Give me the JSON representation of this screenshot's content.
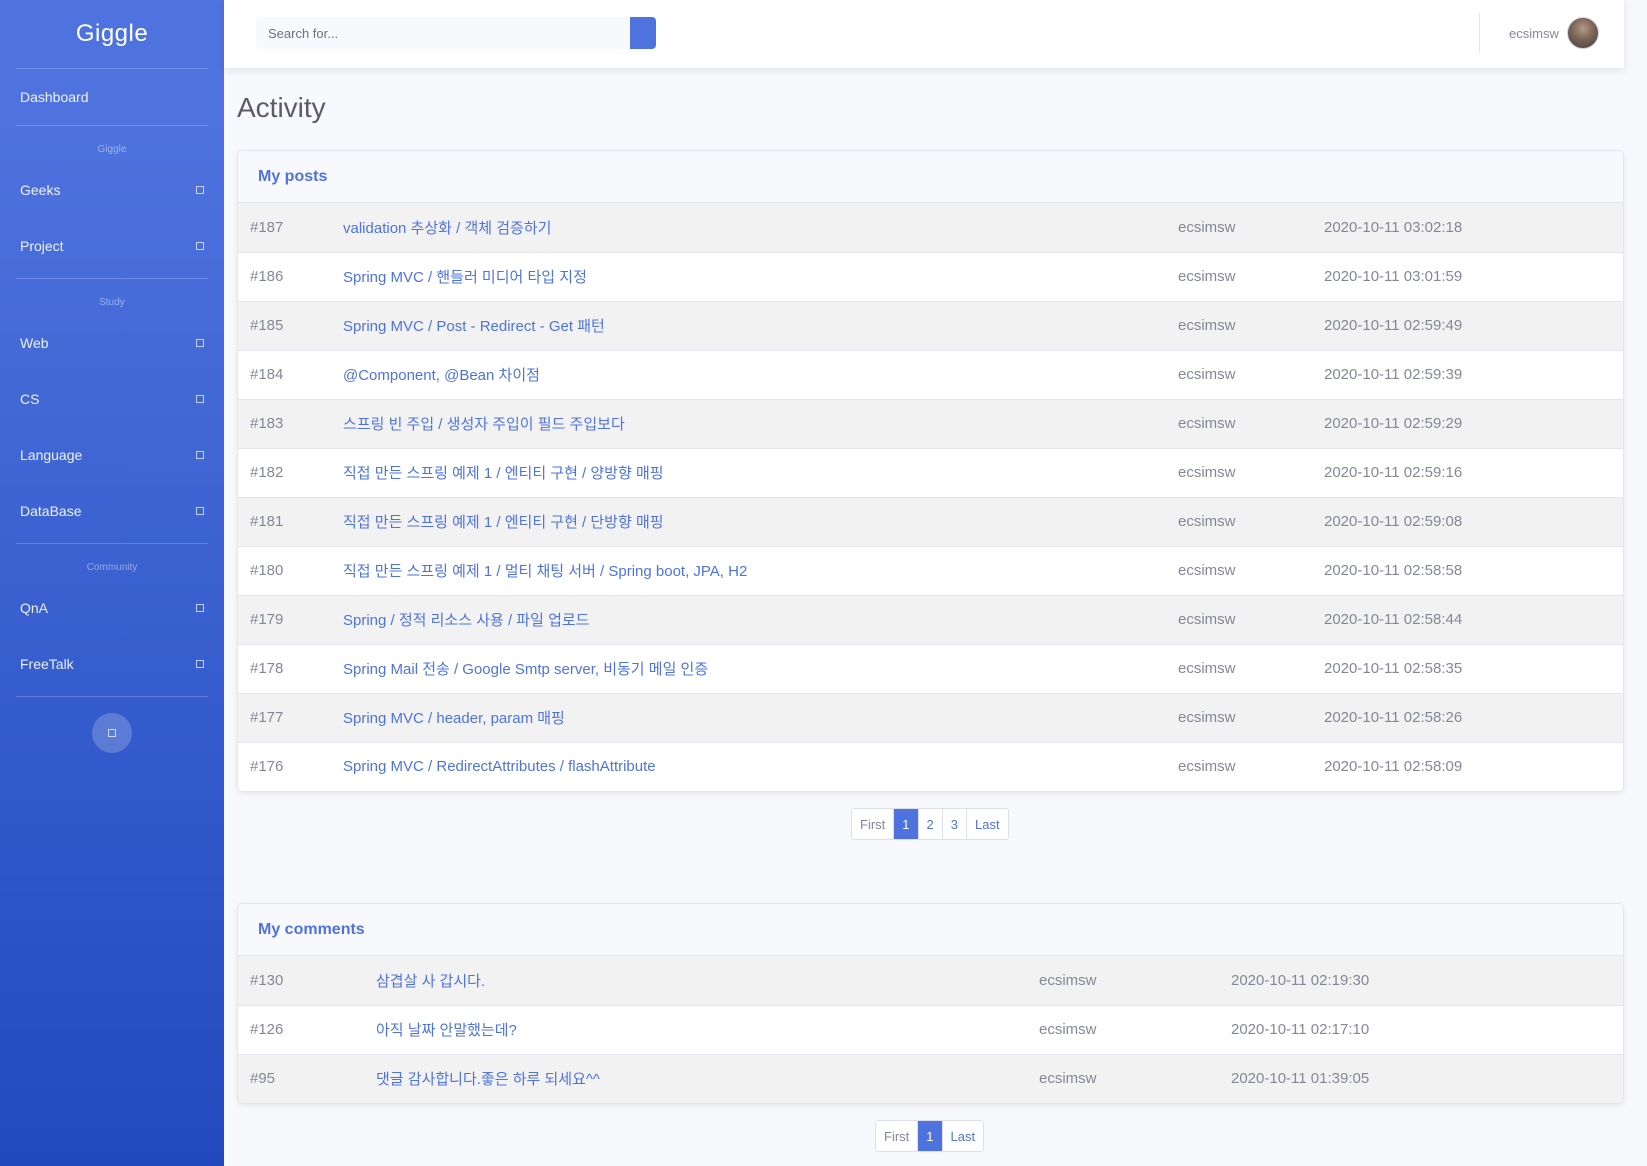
{
  "sidebar": {
    "brand": "Giggle",
    "dashboard": "Dashboard",
    "sections": [
      {
        "heading": "Giggle",
        "items": [
          "Geeks",
          "Project"
        ]
      },
      {
        "heading": "Study",
        "items": [
          "Web",
          "CS",
          "Language",
          "DataBase"
        ]
      },
      {
        "heading": "Community",
        "items": [
          "QnA",
          "FreeTalk"
        ]
      }
    ]
  },
  "topbar": {
    "search_placeholder": "Search for...",
    "username": "ecsimsw"
  },
  "page": {
    "title": "Activity"
  },
  "posts": {
    "header": "My posts",
    "rows": [
      {
        "id": "#187",
        "title": "validation 추상화 / 객체 검증하기",
        "author": "ecsimsw",
        "date": "2020-10-11 03:02:18"
      },
      {
        "id": "#186",
        "title": "Spring MVC / 핸들러 미디어 타입 지정",
        "author": "ecsimsw",
        "date": "2020-10-11 03:01:59"
      },
      {
        "id": "#185",
        "title": "Spring MVC / Post - Redirect - Get 패턴",
        "author": "ecsimsw",
        "date": "2020-10-11 02:59:49"
      },
      {
        "id": "#184",
        "title": "@Component, @Bean 차이점",
        "author": "ecsimsw",
        "date": "2020-10-11 02:59:39"
      },
      {
        "id": "#183",
        "title": "스프링 빈 주입 / 생성자 주입이 필드 주입보다",
        "author": "ecsimsw",
        "date": "2020-10-11 02:59:29"
      },
      {
        "id": "#182",
        "title": "직접 만든 스프링 예제 1 / 엔티티 구현 / 양방향 매핑",
        "author": "ecsimsw",
        "date": "2020-10-11 02:59:16"
      },
      {
        "id": "#181",
        "title": "직접 만든 스프링 예제 1 / 엔티티 구현 / 단방향 매핑",
        "author": "ecsimsw",
        "date": "2020-10-11 02:59:08"
      },
      {
        "id": "#180",
        "title": "직접 만든 스프링 예제 1 / 멀티 채팅 서버 / Spring boot, JPA, H2",
        "author": "ecsimsw",
        "date": "2020-10-11 02:58:58"
      },
      {
        "id": "#179",
        "title": "Spring / 정적 리소스 사용 / 파일 업로드",
        "author": "ecsimsw",
        "date": "2020-10-11 02:58:44"
      },
      {
        "id": "#178",
        "title": "Spring Mail 전송 / Google Smtp server, 비동기 메일 인증",
        "author": "ecsimsw",
        "date": "2020-10-11 02:58:35"
      },
      {
        "id": "#177",
        "title": "Spring MVC / header, param 매핑",
        "author": "ecsimsw",
        "date": "2020-10-11 02:58:26"
      },
      {
        "id": "#176",
        "title": "Spring MVC / RedirectAttributes / flashAttribute",
        "author": "ecsimsw",
        "date": "2020-10-11 02:58:09"
      }
    ],
    "pagination": [
      "First",
      "1",
      "2",
      "3",
      "Last"
    ],
    "active_page": "1"
  },
  "comments": {
    "header": "My comments",
    "rows": [
      {
        "id": "#130",
        "title": "삼겹살 사 갑시다.",
        "author": "ecsimsw",
        "date": "2020-10-11 02:19:30"
      },
      {
        "id": "#126",
        "title": "아직 날짜 안말했는데?",
        "author": "ecsimsw",
        "date": "2020-10-11 02:17:10"
      },
      {
        "id": "#95",
        "title": "댓글 감사합니다.좋은 하루 되세요^^",
        "author": "ecsimsw",
        "date": "2020-10-11 01:39:05"
      }
    ],
    "pagination": [
      "First",
      "1",
      "Last"
    ],
    "active_page": "1"
  }
}
